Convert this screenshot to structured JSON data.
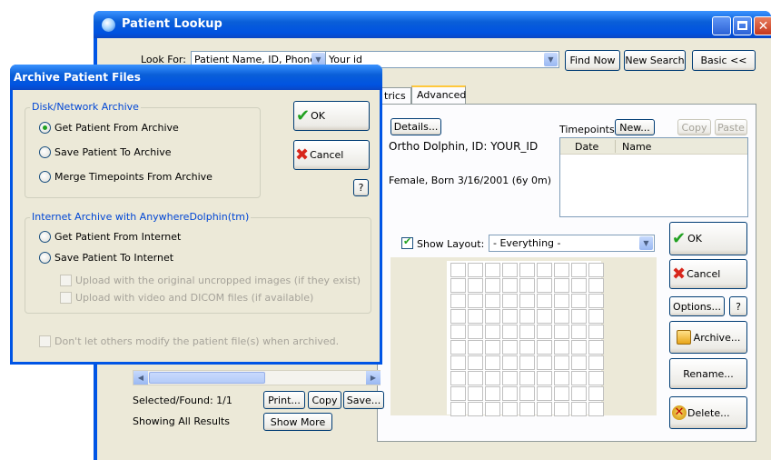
{
  "main_window": {
    "title": "Patient Lookup",
    "look_for_label": "Look For:",
    "look_for_value": "Patient Name, ID, Phone, SSN",
    "search_text": "Your id",
    "find_now": "Find Now",
    "new_search": "New Search",
    "basic": "Basic <<",
    "tabs": [
      "trics",
      "Advanced"
    ],
    "details_button": "Details...",
    "patient_name": "Ortho Dolphin, ID: YOUR_ID",
    "patient_info": "Female, Born 3/16/2001 (6y 0m)",
    "timepoints_label": "Timepoints:",
    "timepoints_new": "New...",
    "copy_tp": "Copy",
    "paste_tp": "Paste",
    "tp_columns": [
      "Date",
      "Name"
    ],
    "show_layout_label": "Show Layout:",
    "layout_value": "- Everything -",
    "ok": "OK",
    "cancel": "Cancel",
    "options": "Options...",
    "help": "?",
    "archive": "Archive...",
    "rename": "Rename...",
    "delete": "Delete...",
    "selected_found": "Selected/Found: 1/1",
    "showing_results": "Showing All Results",
    "print": "Print...",
    "copy": "Copy",
    "save": "Save...",
    "show_more": "Show More"
  },
  "archive_dialog": {
    "title": "Archive Patient Files",
    "group1_title": "Disk/Network Archive",
    "get_from_archive": "Get Patient From Archive",
    "save_to_archive": "Save Patient To Archive",
    "merge_timepoints": "Merge Timepoints From Archive",
    "ok": "OK",
    "cancel": "Cancel",
    "help": "?",
    "group2_title": "Internet Archive with AnywhereDolphin(tm)",
    "get_from_internet": "Get Patient From Internet",
    "save_to_internet": "Save Patient To Internet",
    "upload_uncropped": "Upload with the original uncropped images (if they exist)",
    "upload_video": "Upload with video and DICOM files (if available)",
    "dont_modify": "Don't let others modify the patient file(s) when archived."
  },
  "colors": {
    "title_bar": "#0a5fd8",
    "dialog_bg": "#ece9d8",
    "accent_green": "#21a121",
    "accent_red": "#d8261b"
  }
}
